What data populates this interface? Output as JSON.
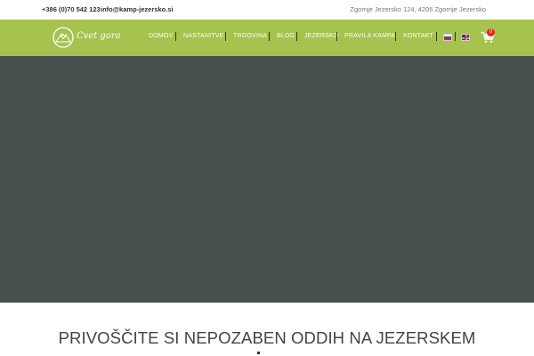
{
  "topbar": {
    "phone": "+386 (0)70 542 123",
    "email": "info@kamp-jezersko.si",
    "address": "Zgornje Jezersko 124, 4206 Zgornje Jezersko"
  },
  "logo": {
    "text": "Cvet gora"
  },
  "nav": {
    "items": [
      "DOMOV",
      "NASTANITVE",
      "TRGOVINA",
      "BLOG",
      "JEZERSKO",
      "PRAVILA KAMPA",
      "KONTAKT"
    ],
    "languages": [
      "sl-flag-icon",
      "en-flag-icon"
    ],
    "cart_count": "0"
  },
  "hero": {
    "color": "#495150"
  },
  "main": {
    "headline": "PRIVOŠČITE SI NEPOZABEN ODDIH NA JEZERSKEM"
  },
  "colors": {
    "nav_bg": "#a6c24f",
    "hero_bg": "#495150",
    "badge": "#e3271d"
  }
}
